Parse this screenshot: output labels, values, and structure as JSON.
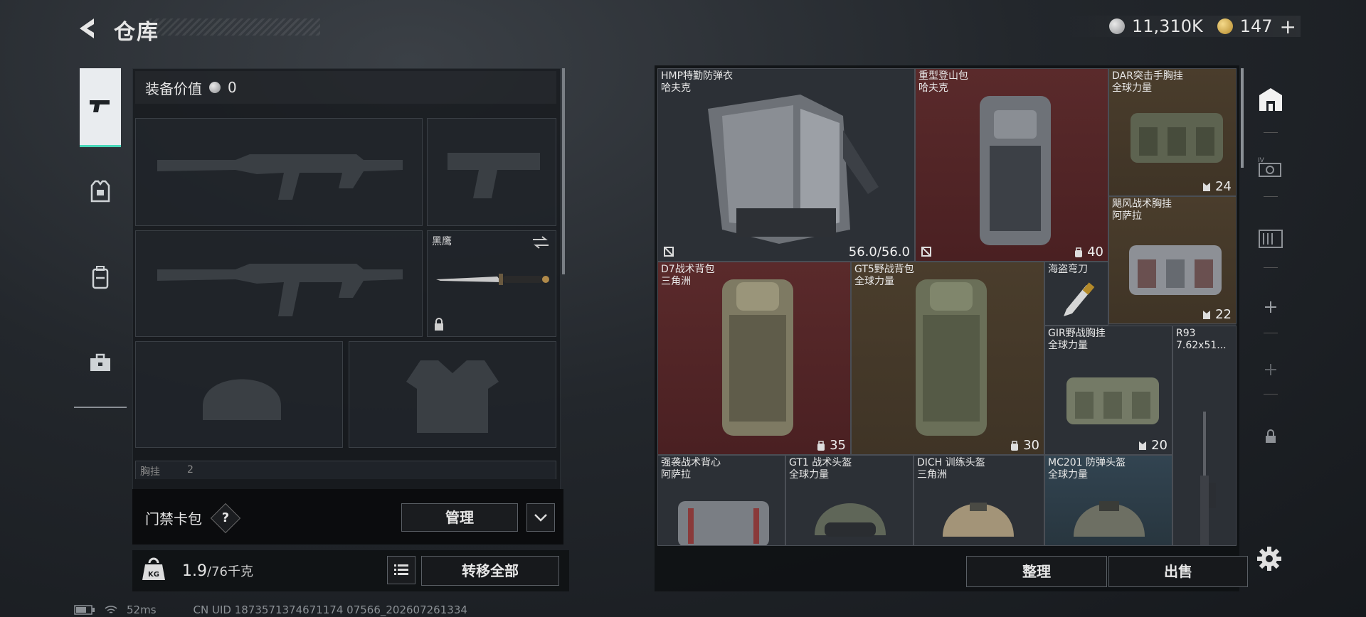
{
  "header": {
    "title": "仓库"
  },
  "currency": [
    {
      "icon": "silver-coin-icon",
      "value": "11,310K"
    },
    {
      "icon": "gold-coin-icon",
      "value": "147",
      "add": "+"
    }
  ],
  "side_tabs": [
    {
      "icon": "pistol-icon",
      "active": true
    },
    {
      "icon": "armor-vest-icon"
    },
    {
      "icon": "backpack-icon"
    },
    {
      "icon": "toolbox-icon"
    }
  ],
  "loadout": {
    "value_label": "装备价值",
    "value": "0",
    "melee_name": "黑鹰",
    "rig_label_partial": "胸挂",
    "rig_count_partial": "2"
  },
  "access_card": {
    "label": "门禁卡包",
    "help": "?",
    "manage": "管理"
  },
  "bottom": {
    "weight_value": "1.9",
    "weight_max": "/76千克",
    "transfer_all": "转移全部"
  },
  "status_bar": {
    "ping": "52ms",
    "uid": "CN UID 1873571374671174 07566_202607261334"
  },
  "storage": {
    "items": [
      {
        "name": "HMP特勤防弹衣",
        "origin": "哈夫克",
        "count": "56.0/56.0"
      },
      {
        "name": "重型登山包",
        "origin": "哈夫克",
        "count": "40"
      },
      {
        "name": "DAR突击手胸挂",
        "origin": "全球力量",
        "count": "24"
      },
      {
        "name": "飓风战术胸挂",
        "origin": "阿萨拉",
        "count": "22"
      },
      {
        "name": "D7战术背包",
        "origin": "三角洲",
        "count": "35"
      },
      {
        "name": "GT5野战背包",
        "origin": "全球力量",
        "count": "30"
      },
      {
        "name": "海盗弯刀",
        "origin": "",
        "count": ""
      },
      {
        "name": "GIR野战胸挂",
        "origin": "全球力量",
        "count": "20"
      },
      {
        "name": "R93",
        "origin": "7.62x51...",
        "count": ""
      },
      {
        "name": "强袭战术背心",
        "origin": "阿萨拉",
        "count": ""
      },
      {
        "name": "GT1 战术头盔",
        "origin": "全球力量",
        "count": ""
      },
      {
        "name": "DICH 训练头盔",
        "origin": "三角洲",
        "count": ""
      },
      {
        "name": "MC201 防弹头盔",
        "origin": "全球力量",
        "count": ""
      }
    ],
    "tidy": "整理",
    "sell": "出售"
  },
  "colors": {
    "accent": "#48d6b8",
    "red_cell": "#5a2a2b",
    "olive_cell": "#4a3d2c",
    "blue_cell": "#324451"
  }
}
